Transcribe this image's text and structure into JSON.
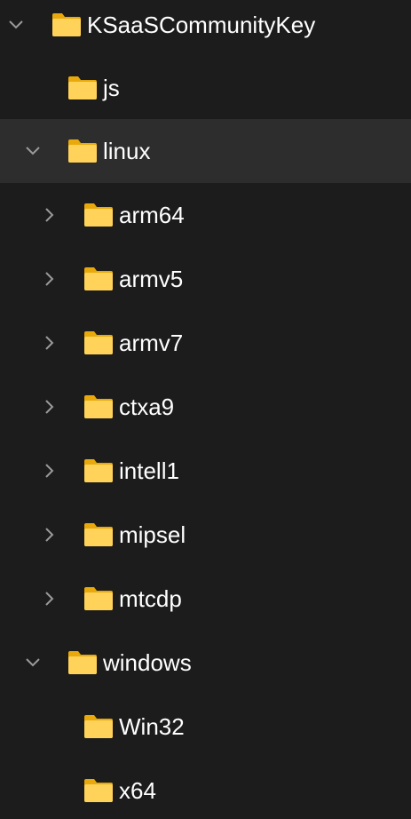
{
  "tree": {
    "root": {
      "label": "KSaaSCommunityKey",
      "icon": "folder-icon",
      "expanded": true
    },
    "js": {
      "label": "js",
      "icon": "folder-icon"
    },
    "linux": {
      "label": "linux",
      "icon": "folder-icon",
      "expanded": true,
      "selected": true
    },
    "arm64": {
      "label": "arm64",
      "icon": "folder-icon",
      "expanded": false
    },
    "armv5": {
      "label": "armv5",
      "icon": "folder-icon",
      "expanded": false
    },
    "armv7": {
      "label": "armv7",
      "icon": "folder-icon",
      "expanded": false
    },
    "ctxa9": {
      "label": "ctxa9",
      "icon": "folder-icon",
      "expanded": false
    },
    "intell1": {
      "label": "intell1",
      "icon": "folder-icon",
      "expanded": false
    },
    "mipsel": {
      "label": "mipsel",
      "icon": "folder-icon",
      "expanded": false
    },
    "mtcdp": {
      "label": "mtcdp",
      "icon": "folder-icon",
      "expanded": false
    },
    "windows": {
      "label": "windows",
      "icon": "folder-icon",
      "expanded": true
    },
    "win32": {
      "label": "Win32",
      "icon": "folder-icon"
    },
    "x64": {
      "label": "x64",
      "icon": "folder-icon"
    }
  },
  "colors": {
    "background": "#1c1c1c",
    "selected_row": "#2d2d2d",
    "text": "#ffffff",
    "chevron": "#9a9a9a",
    "folder_back": "#e8a90c",
    "folder_front": "#ffd25a"
  }
}
